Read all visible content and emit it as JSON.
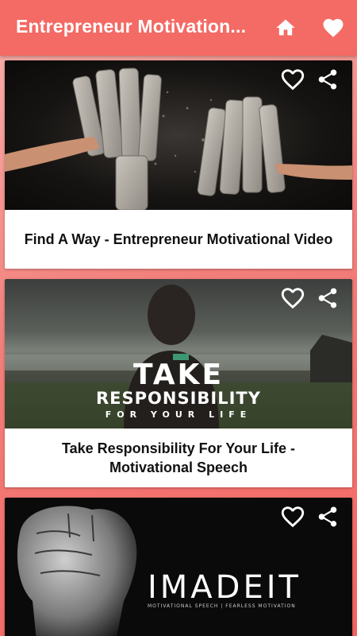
{
  "appbar": {
    "title": "Entrepreneur Motivation...",
    "home_icon": "home-icon",
    "favorites_icon": "heart-icon"
  },
  "colors": {
    "primary": "#f46a64",
    "background_gradient_start": "#f9b3ad",
    "background_gradient_end": "#f46562",
    "card": "#ffffff",
    "caption_text": "#111111"
  },
  "videos": [
    {
      "title": "Find A Way - Entrepreneur Motivational Video",
      "thumbnail": "fists-breaking-stone",
      "favorite_icon": "heart-outline-icon",
      "share_icon": "share-icon"
    },
    {
      "title": "Take Responsibility For Your Life - Motivational Speech",
      "thumbnail": "man-facing-sea",
      "thumb_text_line1": "TAKE",
      "thumb_text_line2": "RESPONSIBILITY",
      "thumb_text_line3": "FOR YOUR LIFE",
      "favorite_icon": "heart-outline-icon",
      "share_icon": "share-icon"
    },
    {
      "title": "",
      "thumbnail": "raised-fist",
      "thumb_text_line1": "IMADEIT",
      "thumb_text_line2": "MOTIVATIONAL SPEECH | FEARLESS MOTIVATION",
      "favorite_icon": "heart-outline-icon",
      "share_icon": "share-icon"
    }
  ]
}
